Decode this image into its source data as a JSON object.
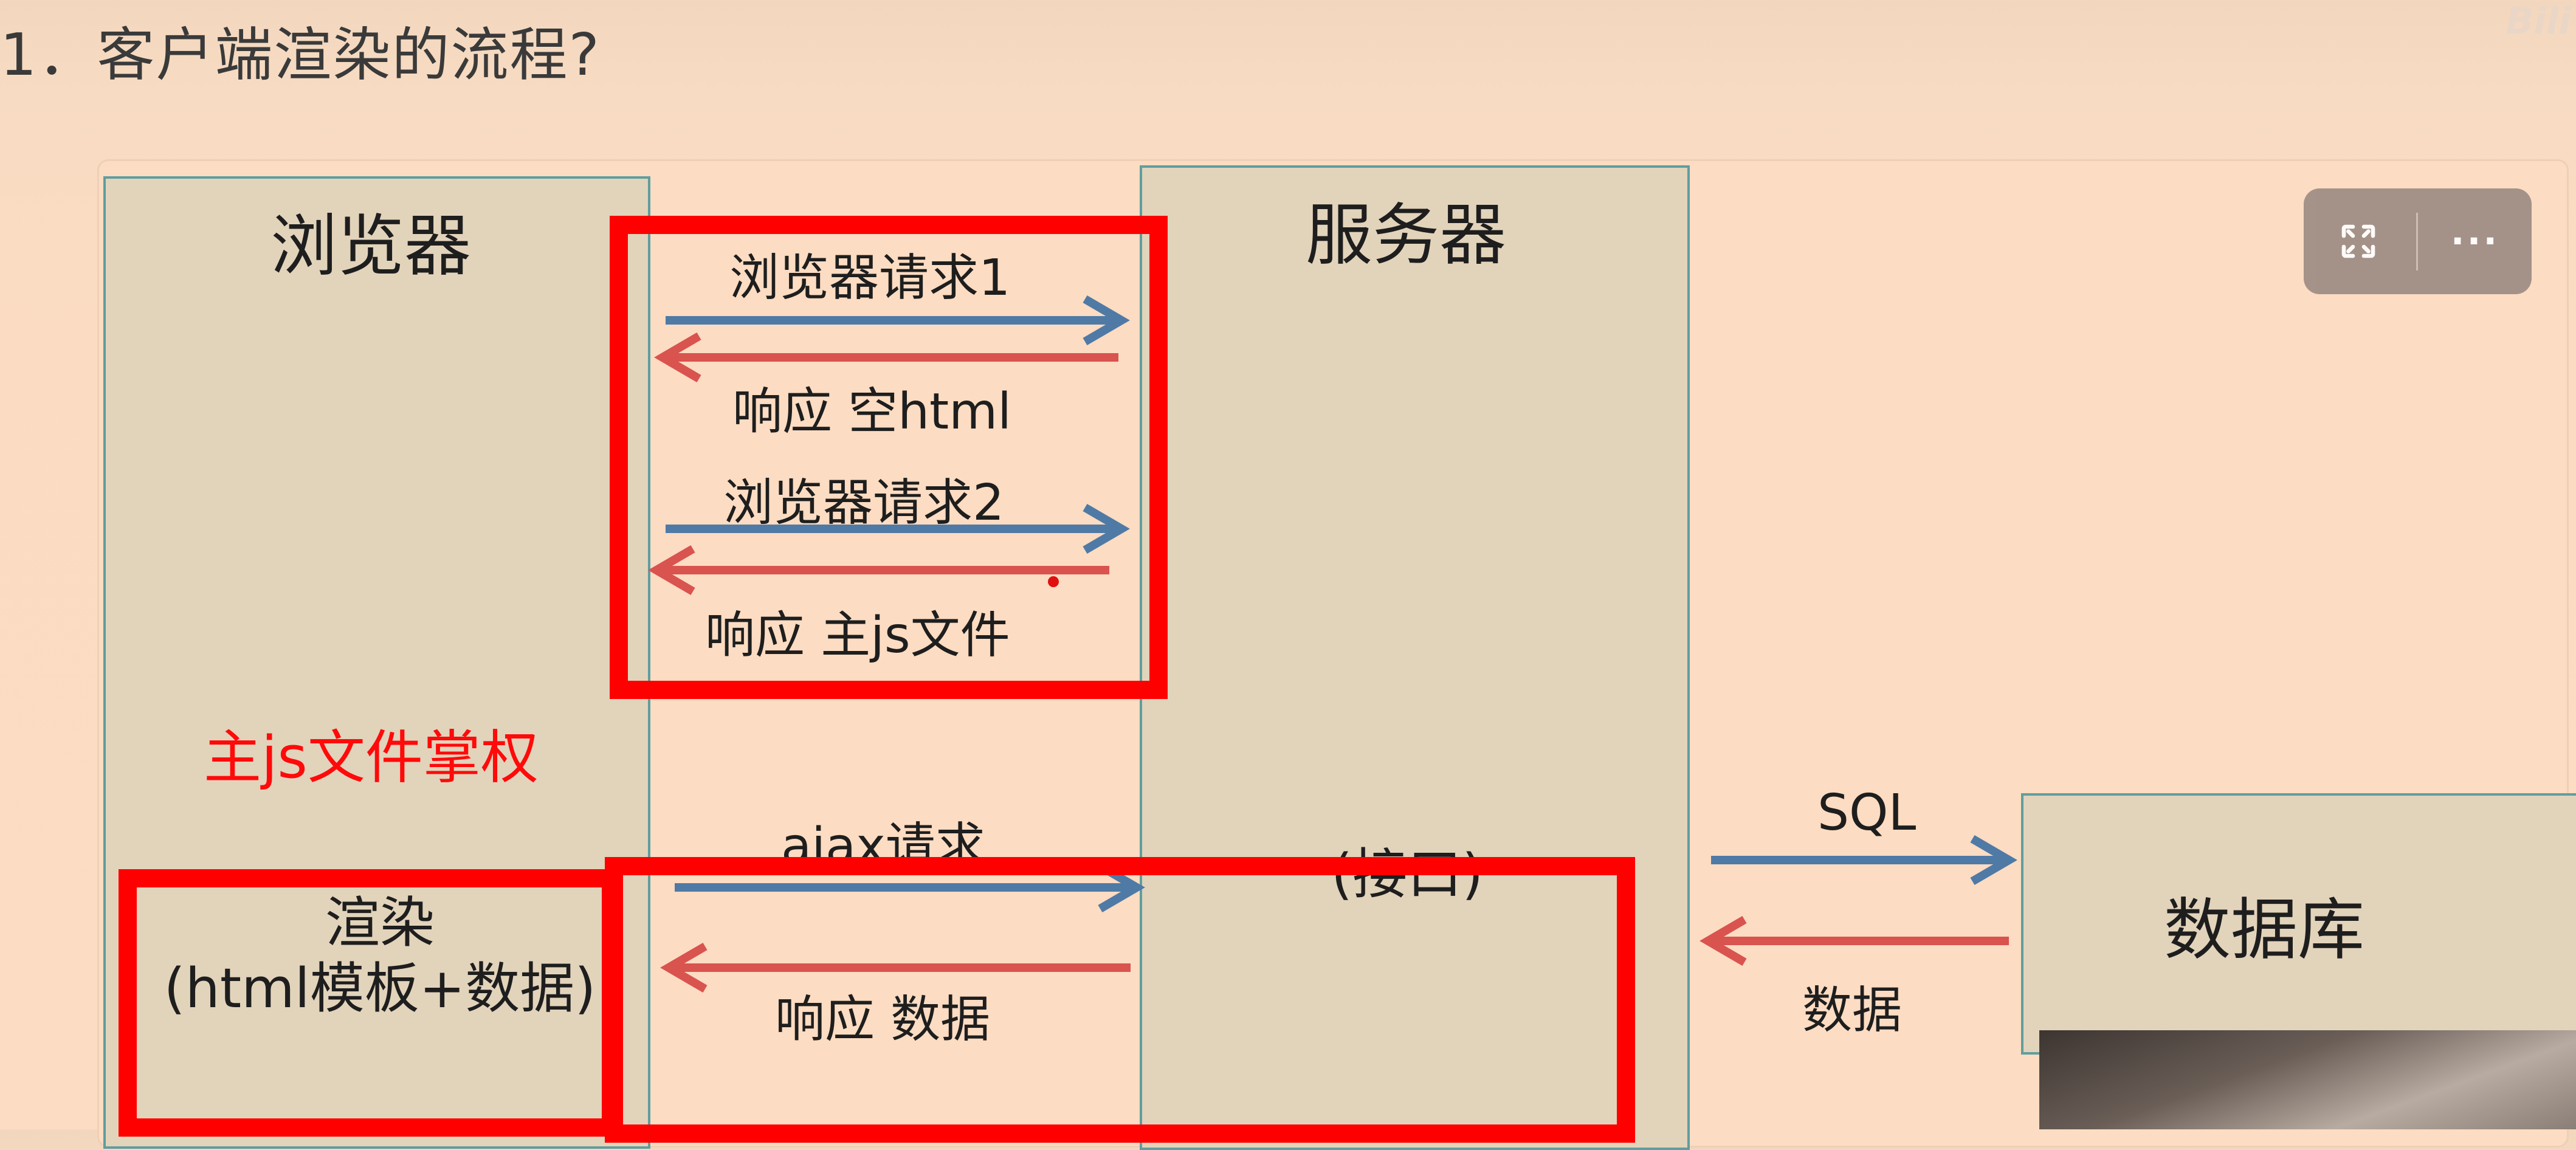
{
  "heading": "1．客户端渲染的流程?",
  "columns": {
    "browser": "浏览器",
    "server": "服务器",
    "database": "数据库"
  },
  "arrows": {
    "req1": "浏览器请求1",
    "resp1": "响应 空html",
    "req2": "浏览器请求2",
    "resp2": "响应 主js文件",
    "ajax": "ajax请求",
    "resp_data": "响应 数据",
    "sql": "SQL",
    "db_data": "数据"
  },
  "browser_control_note": "主js文件掌权",
  "render_box": {
    "line1": "渲染",
    "line2": "(html模板+数据)"
  },
  "server_interface": "(接口)",
  "toolbar": {
    "expand_icon": "expand-icon",
    "more_label": "···"
  },
  "colors": {
    "request_arrow": "#4f7aa6",
    "response_arrow": "#d9534f",
    "highlight": "#ff0000",
    "column_fill": "#e2d3bb",
    "column_border": "#5f9e9e"
  }
}
